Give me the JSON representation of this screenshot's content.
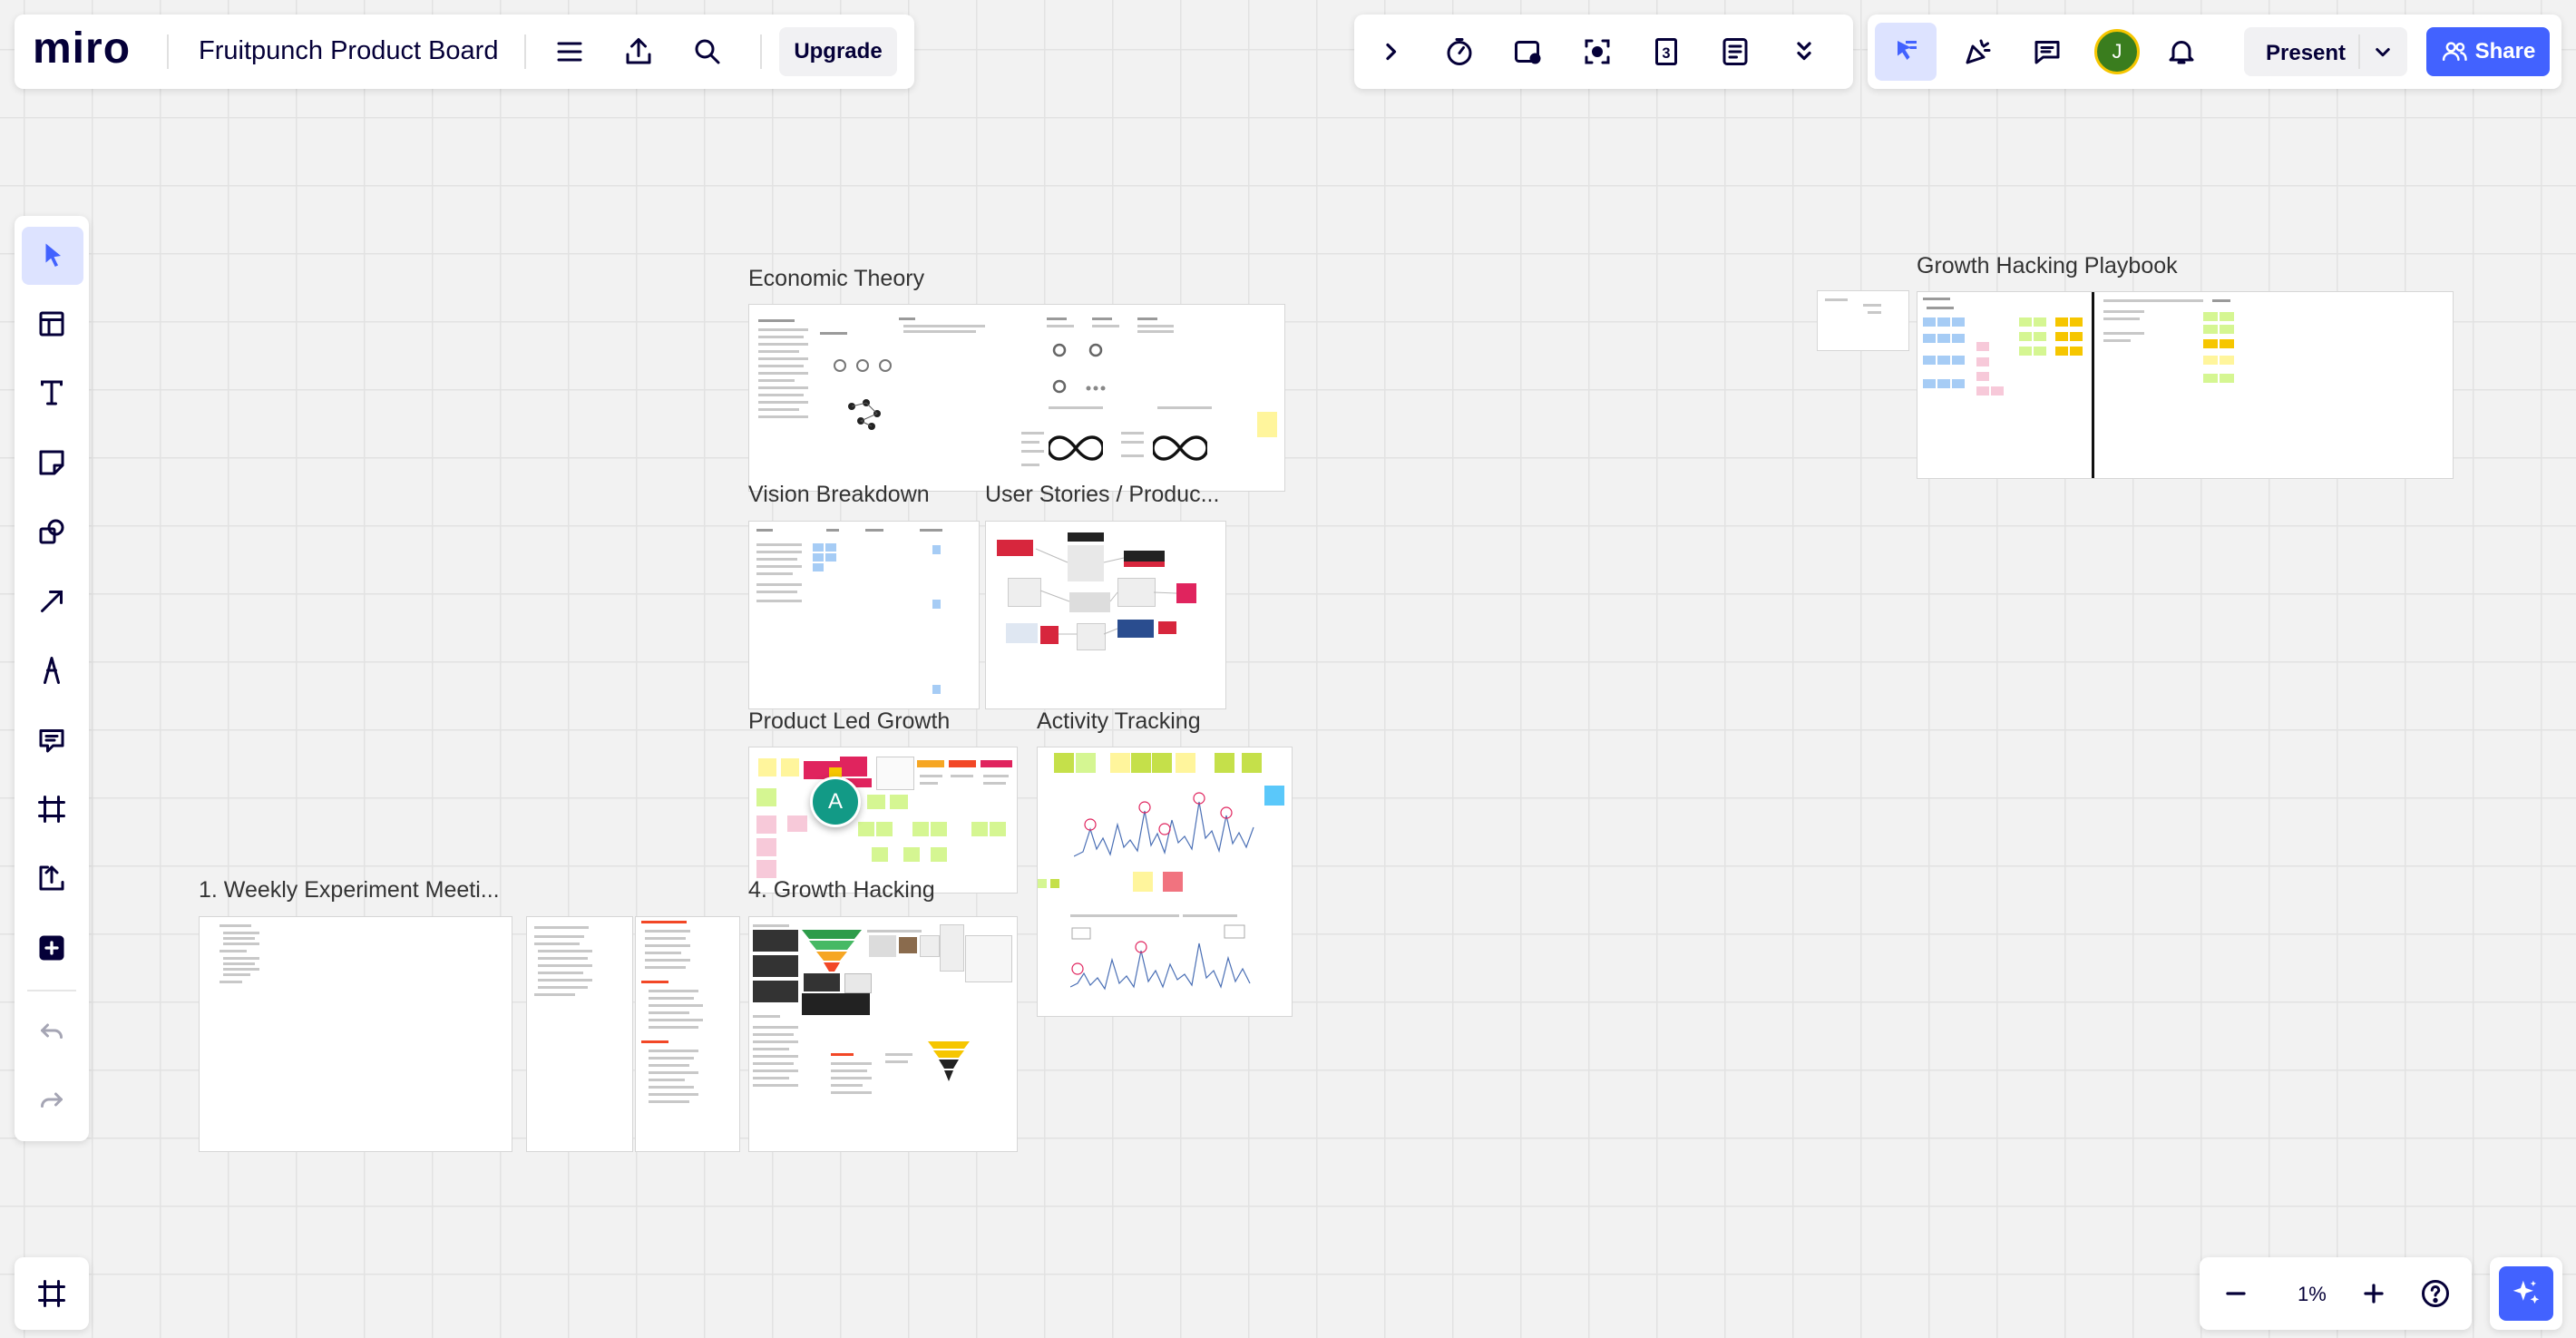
{
  "app": {
    "logo": "miro",
    "board_title": "Fruitpunch Product Board"
  },
  "toolbar": {
    "upgrade_label": "Upgrade",
    "present_label": "Present",
    "share_label": "Share"
  },
  "user": {
    "avatar_initial": "J"
  },
  "collaborator": {
    "cursor_initial": "A"
  },
  "zoom": {
    "level": "1%"
  },
  "frames": {
    "economic_theory": "Economic Theory",
    "growth_hacking_playbook": "Growth Hacking Playbook",
    "vision_breakdown": "Vision Breakdown",
    "user_stories": "User Stories / Produc...",
    "product_led_growth": "Product Led Growth",
    "activity_tracking": "Activity Tracking",
    "weekly_experiment": "1. Weekly Experiment Meeti...",
    "growth_hacking": "4. Growth Hacking"
  },
  "colors": {
    "accent_blue": "#4262ff",
    "selected_bg": "#dde3ff",
    "avatar_bg": "#3a7d1e",
    "avatar_ring": "#f6c600",
    "collaborator_bg": "#129a86"
  },
  "icons": {
    "top_left": [
      "menu-icon",
      "export-icon",
      "search-icon"
    ],
    "top_right": [
      "chevron-right-icon",
      "timer-icon",
      "video-icon",
      "focus-icon",
      "counter-icon",
      "notes-icon",
      "chevron-double-down-icon"
    ],
    "collab": [
      "cursor-select-icon",
      "reaction-icon",
      "comments-icon",
      "bell-icon"
    ],
    "left_tools": [
      "select-icon",
      "templates-icon",
      "text-icon",
      "sticky-note-icon",
      "shapes-icon",
      "arrow-line-icon",
      "pen-icon",
      "comment-icon",
      "frame-icon",
      "upload-icon",
      "more-apps-icon",
      "undo-icon",
      "redo-icon"
    ],
    "bottom_left": "frames-list-icon",
    "zoom": [
      "zoom-out-icon",
      "zoom-in-icon",
      "help-icon",
      "ai-sparkle-icon"
    ]
  }
}
